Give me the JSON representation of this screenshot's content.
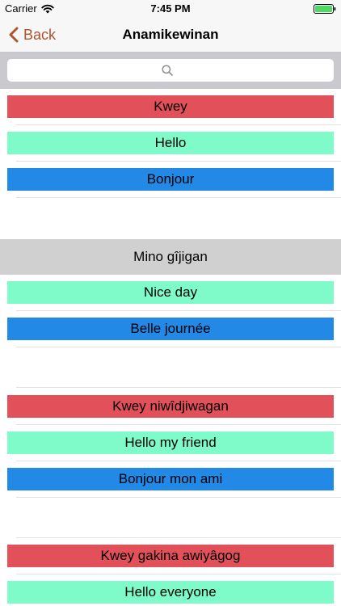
{
  "status_bar": {
    "carrier": "Carrier",
    "time": "7:45 PM",
    "wifi_icon": "wifi-icon",
    "battery_icon": "battery-icon"
  },
  "nav": {
    "back_label": "Back",
    "title": "Anamikewinan"
  },
  "search": {
    "placeholder": "",
    "value": "",
    "icon": "search-icon"
  },
  "colors": {
    "accent": "#b0542c",
    "row_red": "#e2505a",
    "row_green": "#7efbc8",
    "row_blue": "#2289e7",
    "section_header": "#d0d0d0"
  },
  "sections": [
    {
      "header": "",
      "items": [
        {
          "text": "Kwey",
          "color": "red"
        },
        {
          "text": "Hello",
          "color": "green"
        },
        {
          "text": "Bonjour",
          "color": "blue"
        }
      ]
    },
    {
      "header": "Mino gîjigan",
      "items": [
        {
          "text": "Nice day",
          "color": "green"
        },
        {
          "text": "Belle journée",
          "color": "blue"
        }
      ]
    },
    {
      "header": "",
      "items": [
        {
          "text": "Kwey niwîdjiwagan",
          "color": "red"
        },
        {
          "text": "Hello my friend",
          "color": "green"
        },
        {
          "text": "Bonjour mon ami",
          "color": "blue"
        }
      ]
    },
    {
      "header": "",
      "items": [
        {
          "text": "Kwey gakina awiyâgog",
          "color": "red"
        },
        {
          "text": "Hello everyone",
          "color": "green"
        }
      ]
    }
  ]
}
